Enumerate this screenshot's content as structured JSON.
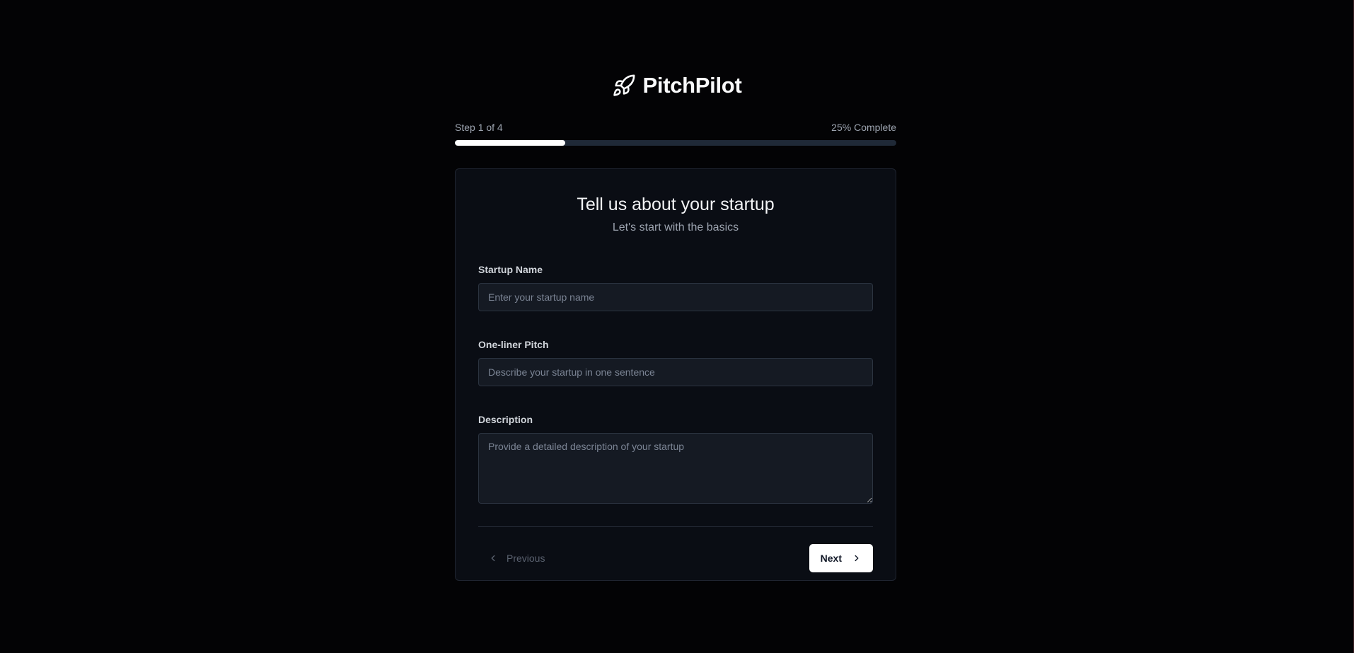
{
  "brand": {
    "name": "PitchPilot",
    "icon": "rocket-icon"
  },
  "progress": {
    "step_label": "Step 1 of 4",
    "percent_label": "25% Complete",
    "fraction": 0.25
  },
  "form": {
    "title": "Tell us about your startup",
    "subtitle": "Let's start with the basics",
    "startup_name": {
      "label": "Startup Name",
      "placeholder": "Enter your startup name",
      "value": ""
    },
    "pitch": {
      "label": "One-liner Pitch",
      "placeholder": "Describe your startup in one sentence",
      "value": ""
    },
    "description": {
      "label": "Description",
      "placeholder": "Provide a detailed description of your startup",
      "value": ""
    }
  },
  "nav": {
    "previous_label": "Previous",
    "next_label": "Next"
  },
  "colors": {
    "background": "#030305",
    "card": "#0a0d14",
    "accent": "#ffffff",
    "track": "#1f2937"
  }
}
